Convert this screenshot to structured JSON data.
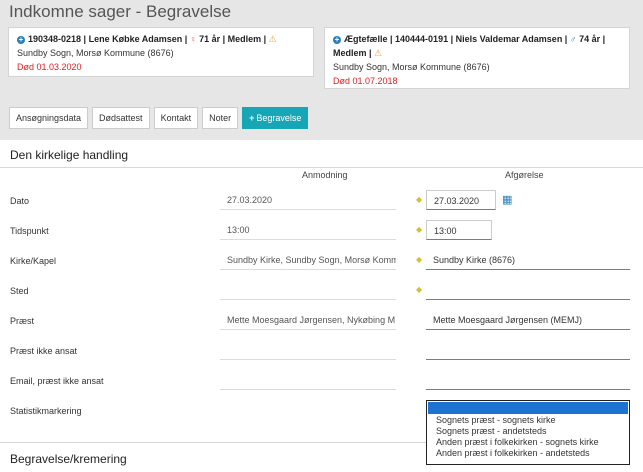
{
  "header": {
    "title": "Indkomne sager - Begravelse"
  },
  "persons": [
    {
      "id_name": "190348-0218 | Lene Købke Adamsen |",
      "gender_symbol": "♀",
      "age": "71 år | Medlem |",
      "parish": "Sundby Sogn, Morsø Kommune (8676)",
      "death": "Død 01.03.2020"
    },
    {
      "id_name": "Ægtefælle | 140444-0191 | Niels Valdemar Adamsen |",
      "gender_symbol": "♂",
      "age": "74 år |",
      "membership": "Medlem |",
      "parish": "Sundby Sogn, Morsø Kommune (8676)",
      "death": "Død 01.07.2018"
    }
  ],
  "tabs": [
    {
      "label": "Ansøgningsdata"
    },
    {
      "label": "Dødsattest"
    },
    {
      "label": "Kontakt"
    },
    {
      "label": "Noter"
    },
    {
      "label": "Begravelse"
    }
  ],
  "section1": {
    "title": "Den kirkelige handling",
    "col_request": "Anmodning",
    "col_decision": "Afgørelse",
    "rows": [
      {
        "label": "Dato",
        "request": "27.03.2020",
        "decision": "27.03.2020"
      },
      {
        "label": "Tidspunkt",
        "request": "13:00",
        "decision": "13:00"
      },
      {
        "label": "Kirke/Kapel",
        "request": "Sundby Kirke, Sundby Sogn, Morsø Kommune",
        "decision": "Sundby Kirke (8676)"
      },
      {
        "label": "Sted",
        "request": "",
        "decision": ""
      },
      {
        "label": "Præst",
        "request": "Mette Moesgaard Jørgensen, Nykøbing M Sogn",
        "decision": "Mette Moesgaard Jørgensen (MEMJ)"
      },
      {
        "label": "Præst ikke ansat",
        "request": "",
        "decision": ""
      },
      {
        "label": "Email, præst ikke ansat",
        "request": "",
        "decision": ""
      },
      {
        "label": "Statistikmarkering"
      }
    ],
    "statistics_options": [
      "Sognets præst - sognets kirke",
      "Sognets præst - andetsteds",
      "Anden præst i folkekirken - sognets kirke",
      "Anden præst i folkekirken - andetsteds"
    ]
  },
  "section2": {
    "title": "Begravelse/kremering"
  },
  "icons": {
    "add": "plus-circle-icon",
    "warning": "warning-icon",
    "calendar": "calendar-icon",
    "required": "diamond-icon"
  },
  "colors": {
    "accent": "#16a6b6",
    "link": "#2a7fb8",
    "death": "#e02020",
    "selection": "#1e73d2"
  }
}
